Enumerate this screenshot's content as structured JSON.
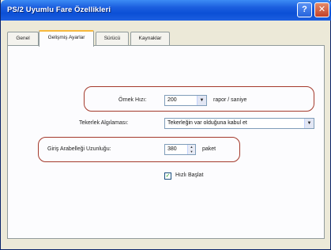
{
  "window": {
    "title": "PS/2 Uyumlu Fare Özellikleri",
    "help_glyph": "?",
    "close_glyph": "✕"
  },
  "tabs": [
    {
      "label": "Genel",
      "active": false
    },
    {
      "label": "Gelişmiş Ayarlar",
      "active": true
    },
    {
      "label": "Sürücü",
      "active": false
    },
    {
      "label": "Kaynaklar",
      "active": false
    }
  ],
  "settings": {
    "sample_rate": {
      "label": "Örnek Hızı:",
      "value": "200",
      "unit": "rapor / saniye"
    },
    "wheel_detection": {
      "label": "Tekerlek Algılaması:",
      "value": "Tekerleğin var olduğuna kabul et"
    },
    "input_buffer": {
      "label": "Giriş Arabelleği Uzunluğu:",
      "value": "380",
      "unit": "paket"
    },
    "fast_init": {
      "label": "Hızlı Başlat",
      "checked": true
    }
  },
  "icons": {
    "combo_arrow": "chevron-down-icon",
    "spin_up": "spin-up-icon",
    "spin_down": "spin-down-icon",
    "check": "checkmark-icon"
  },
  "colors": {
    "titlebar": "#0b4fd6",
    "highlight_ring": "#a43a2c",
    "tab_accent": "#f7b93d"
  }
}
